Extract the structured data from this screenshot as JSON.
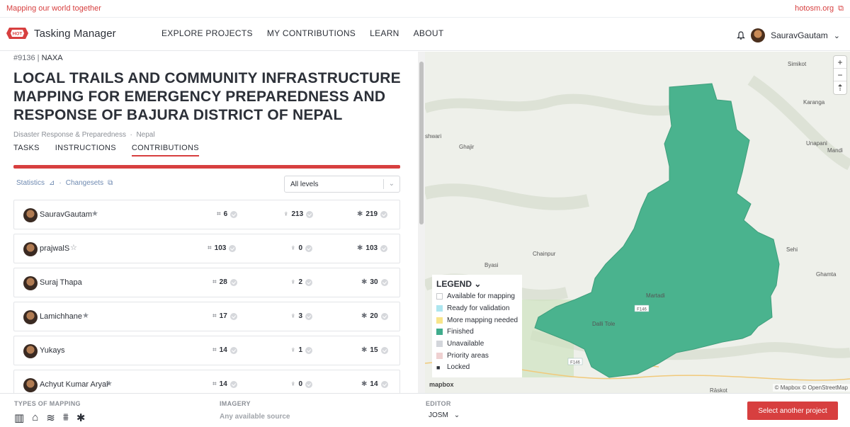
{
  "topbar": {
    "tagline": "Mapping our world together",
    "site_link": "hotosm.org"
  },
  "header": {
    "app_name": "Tasking Manager",
    "logo_text": "HOT",
    "nav": [
      "EXPLORE PROJECTS",
      "MY CONTRIBUTIONS",
      "LEARN",
      "ABOUT"
    ],
    "username": "SauravGautam"
  },
  "project": {
    "id": "#9136",
    "org": "NAXA",
    "title": "LOCAL TRAILS AND COMMUNITY INFRASTRUCTURE MAPPING FOR EMERGENCY PREPAREDNESS AND RESPONSE OF BAJURA DISTRICT OF NEPAL",
    "campaign": "Disaster Response & Preparedness",
    "country": "Nepal",
    "tabs": [
      "TASKS",
      "INSTRUCTIONS",
      "CONTRIBUTIONS"
    ],
    "active_tab": "CONTRIBUTIONS"
  },
  "contributions": {
    "stats_link": "Statistics",
    "changesets_link": "Changesets",
    "level_filter": "All levels",
    "rows": [
      {
        "user": "SauravGautam",
        "mapped": "6",
        "validated": "213",
        "total": "219"
      },
      {
        "user": "prajwalS",
        "mapped": "103",
        "validated": "0",
        "total": "103"
      },
      {
        "user": "Suraj Thapa",
        "mapped": "28",
        "validated": "2",
        "total": "30"
      },
      {
        "user": "Lamichhane",
        "mapped": "17",
        "validated": "3",
        "total": "20"
      },
      {
        "user": "Yukays",
        "mapped": "14",
        "validated": "1",
        "total": "15"
      },
      {
        "user": "Achyut Kumar Aryal",
        "mapped": "14",
        "validated": "0",
        "total": "14"
      }
    ]
  },
  "map": {
    "places": [
      "Simikot",
      "Karanga",
      "Unapani",
      "Mandi",
      "shwari",
      "Ghajir",
      "Chainpur",
      "Byasi",
      "Sehi",
      "Ghamta",
      "Martadi",
      "Dalli Tole",
      "Rāskot"
    ],
    "road_labels": [
      "F146",
      "F146"
    ],
    "zoom_in": "+",
    "zoom_out": "−",
    "reset": "⇡",
    "attribution": "© Mapbox © OpenStreetMap",
    "mapbox_logo": "mapbox",
    "finished_color": "#4ab38e"
  },
  "legend": {
    "title": "LEGEND",
    "items": [
      {
        "label": "Available for mapping",
        "color": "#ffffff"
      },
      {
        "label": "Ready for validation",
        "color": "#ade6ef"
      },
      {
        "label": "More mapping needed",
        "color": "#f8e58a"
      },
      {
        "label": "Finished",
        "color": "#40ac8c"
      },
      {
        "label": "Unavailable",
        "color": "#d3d6db"
      },
      {
        "label": "Priority areas",
        "color": "#efd1d1"
      },
      {
        "label": "Locked",
        "color": "#2c3038"
      }
    ]
  },
  "footer": {
    "types_label": "TYPES OF MAPPING",
    "imagery_label": "IMAGERY",
    "imagery_value": "Any available source",
    "editor_label": "EDITOR",
    "editor_value": "JOSM",
    "cta": "Select another project"
  }
}
